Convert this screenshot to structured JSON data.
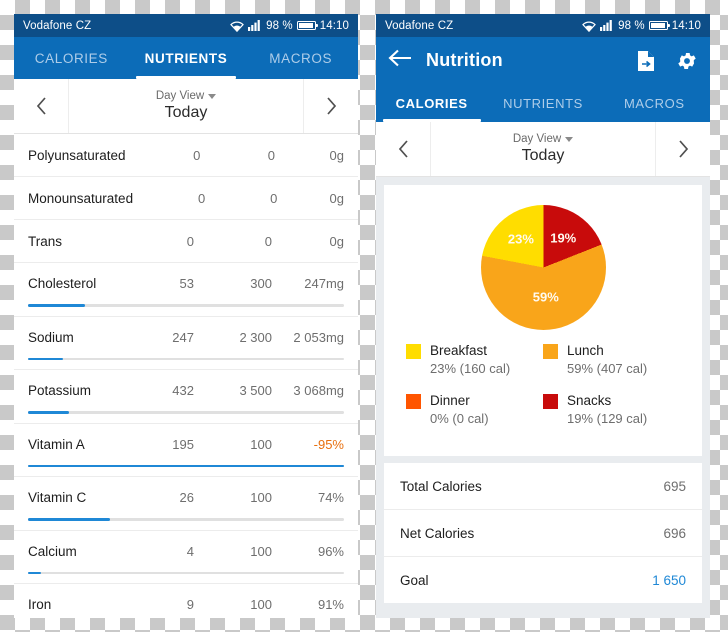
{
  "colors": {
    "status_bar": "#0d4e88",
    "app_bar": "#0c6cb8",
    "accent_blue": "#1f88d6",
    "breakfast": "#FFDD00",
    "lunch": "#F9A51A",
    "dinner": "#FF5500",
    "snacks": "#C80B0B",
    "negative": "#e8700f"
  },
  "status_bar": {
    "carrier": "Vodafone CZ",
    "wifi_icon": "wifi-icon",
    "signal_icon": "signal-bars-icon",
    "battery_percent": "98 %",
    "battery_icon": "battery-icon",
    "clock": "14:10"
  },
  "left_phone": {
    "tabs": [
      {
        "label": "CALORIES",
        "active": false
      },
      {
        "label": "NUTRIENTS",
        "active": true
      },
      {
        "label": "MACROS",
        "active": false
      }
    ],
    "day_nav": {
      "prev_icon": "chevron-left-icon",
      "next_icon": "chevron-right-icon",
      "view_label": "Day View",
      "caret_icon": "chevron-down-icon",
      "current_day": "Today"
    },
    "nutrients": [
      {
        "name": "Polyunsaturated",
        "consumed": "0",
        "goal": "0",
        "remaining": "0g",
        "progress": 0,
        "has_bar": false,
        "negative": false
      },
      {
        "name": "Monounsaturated",
        "consumed": "0",
        "goal": "0",
        "remaining": "0g",
        "progress": 0,
        "has_bar": false,
        "negative": false
      },
      {
        "name": "Trans",
        "consumed": "0",
        "goal": "0",
        "remaining": "0g",
        "progress": 0,
        "has_bar": false,
        "negative": false
      },
      {
        "name": "Cholesterol",
        "consumed": "53",
        "goal": "300",
        "remaining": "247mg",
        "progress": 18,
        "has_bar": true,
        "negative": false
      },
      {
        "name": "Sodium",
        "consumed": "247",
        "goal": "2 300",
        "remaining": "2 053mg",
        "progress": 11,
        "has_bar": true,
        "negative": false
      },
      {
        "name": "Potassium",
        "consumed": "432",
        "goal": "3 500",
        "remaining": "3 068mg",
        "progress": 13,
        "has_bar": true,
        "negative": false
      },
      {
        "name": "Vitamin A",
        "consumed": "195",
        "goal": "100",
        "remaining": "-95%",
        "progress": 100,
        "has_bar": true,
        "negative": true
      },
      {
        "name": "Vitamin C",
        "consumed": "26",
        "goal": "100",
        "remaining": "74%",
        "progress": 26,
        "has_bar": true,
        "negative": false
      },
      {
        "name": "Calcium",
        "consumed": "4",
        "goal": "100",
        "remaining": "96%",
        "progress": 4,
        "has_bar": true,
        "negative": false
      },
      {
        "name": "Iron",
        "consumed": "9",
        "goal": "100",
        "remaining": "91%",
        "progress": 9,
        "has_bar": true,
        "negative": false
      }
    ]
  },
  "right_phone": {
    "app_bar": {
      "back_icon": "back-arrow-icon",
      "title": "Nutrition",
      "export_icon": "export-document-icon",
      "settings_icon": "gear-icon"
    },
    "tabs": [
      {
        "label": "CALORIES",
        "active": true
      },
      {
        "label": "NUTRIENTS",
        "active": false
      },
      {
        "label": "MACROS",
        "active": false
      }
    ],
    "day_nav": {
      "prev_icon": "chevron-left-icon",
      "next_icon": "chevron-right-icon",
      "view_label": "Day View",
      "caret_icon": "chevron-down-icon",
      "current_day": "Today"
    },
    "legend": [
      {
        "label": "Breakfast",
        "detail": "23% (160 cal)",
        "color": "#FFDD00"
      },
      {
        "label": "Lunch",
        "detail": "59% (407 cal)",
        "color": "#F9A51A"
      },
      {
        "label": "Dinner",
        "detail": "0% (0 cal)",
        "color": "#FF5500"
      },
      {
        "label": "Snacks",
        "detail": "19% (129 cal)",
        "color": "#C80B0B"
      }
    ],
    "summary": [
      {
        "label": "Total Calories",
        "value": "695",
        "link": false
      },
      {
        "label": "Net Calories",
        "value": "696",
        "link": false
      },
      {
        "label": "Goal",
        "value": "1 650",
        "link": true
      }
    ]
  },
  "chart_data": {
    "type": "pie",
    "title": "Calories by meal",
    "categories": [
      "Snacks",
      "Lunch",
      "Breakfast",
      "Dinner"
    ],
    "values": [
      19,
      59,
      23,
      0
    ],
    "calories": [
      129,
      407,
      160,
      0
    ],
    "unit": "%",
    "colors": [
      "#C80B0B",
      "#F9A51A",
      "#FFDD00",
      "#FF5500"
    ],
    "slice_labels": [
      "19%",
      "59%",
      "23%"
    ],
    "total_calories": 695,
    "legend_position": "bottom"
  }
}
